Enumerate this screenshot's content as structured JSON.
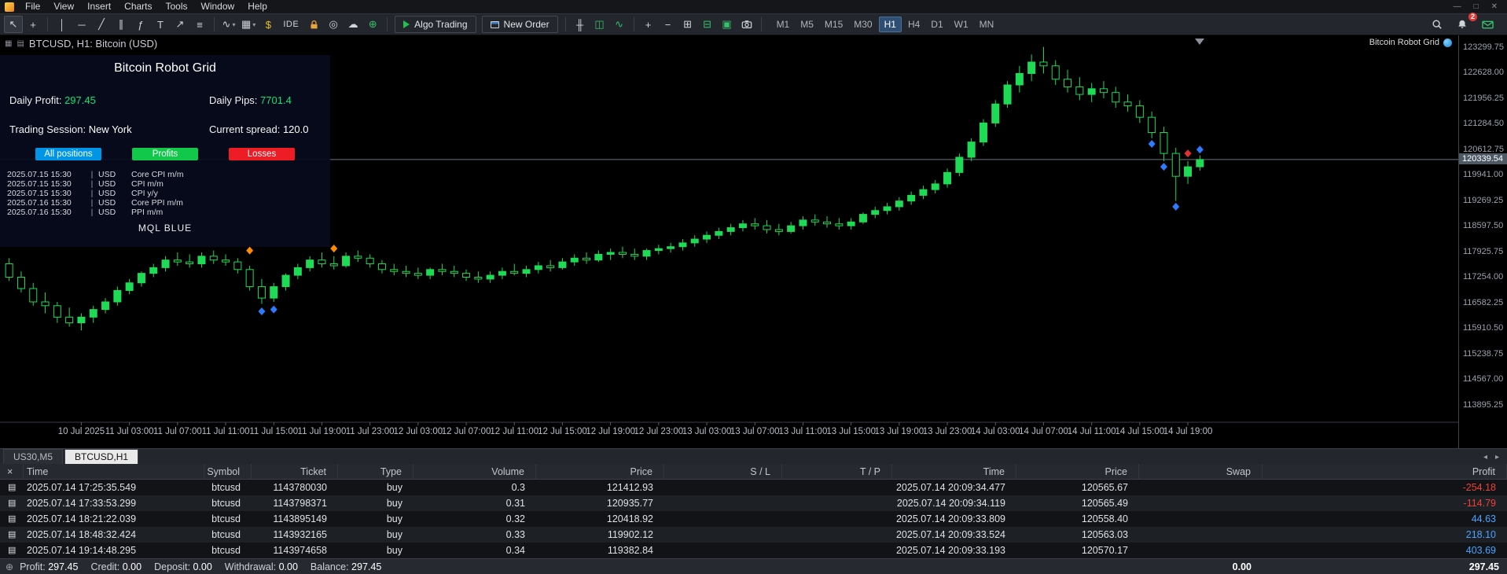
{
  "menu": {
    "items": [
      "File",
      "View",
      "Insert",
      "Charts",
      "Tools",
      "Window",
      "Help"
    ]
  },
  "window_controls": {
    "minimize": "—",
    "maximize": "□",
    "close": "✕"
  },
  "toolbar": {
    "items": [
      {
        "k": "tool",
        "n": "cursor-tool",
        "g": "↖",
        "sel": true
      },
      {
        "k": "tool",
        "n": "crosshair-tool",
        "g": "+"
      },
      {
        "k": "sep"
      },
      {
        "k": "tool",
        "n": "vertical-line-tool",
        "g": "│"
      },
      {
        "k": "tool",
        "n": "horizontal-line-tool",
        "g": "─"
      },
      {
        "k": "tool",
        "n": "trendline-tool",
        "g": "╱"
      },
      {
        "k": "tool",
        "n": "equidistant-channel-tool",
        "g": "∥"
      },
      {
        "k": "tool",
        "n": "fibonacci-tool",
        "g": "ƒ"
      },
      {
        "k": "tool",
        "n": "text-tool",
        "g": "T"
      },
      {
        "k": "tool",
        "n": "arrows-tool",
        "g": "↗"
      },
      {
        "k": "tool",
        "n": "objects-list-icon",
        "g": "≡"
      },
      {
        "k": "sep"
      },
      {
        "k": "tool",
        "n": "indicators-icon",
        "g": "∿",
        "caret": true
      },
      {
        "k": "tool",
        "n": "chart-template-icon",
        "g": "▦",
        "caret": true
      },
      {
        "k": "tool",
        "n": "dollar-icon",
        "g": "$",
        "c": "#e8c210"
      },
      {
        "k": "ide",
        "n": "ide-button",
        "label": "IDE"
      },
      {
        "k": "svg",
        "n": "lock-icon",
        "svg": "lock"
      },
      {
        "k": "tool",
        "n": "signals-icon",
        "g": "◎"
      },
      {
        "k": "tool",
        "n": "cloud-icon",
        "g": "☁"
      },
      {
        "k": "tool",
        "n": "community-icon",
        "g": "⊕",
        "c": "#35c06a"
      },
      {
        "k": "sep"
      },
      {
        "k": "algo",
        "n": "algo-trading-button",
        "label": "Algo Trading"
      },
      {
        "k": "neworder",
        "n": "new-order-button",
        "label": "New Order"
      },
      {
        "k": "sep"
      },
      {
        "k": "tool",
        "n": "bar-chart-icon",
        "g": "╫"
      },
      {
        "k": "tool",
        "n": "candlestick-chart-icon",
        "g": "◫",
        "c": "#35c06a"
      },
      {
        "k": "tool",
        "n": "line-chart-icon",
        "g": "∿",
        "c": "#35c06a"
      },
      {
        "k": "sep"
      },
      {
        "k": "tool",
        "n": "zoom-in-icon",
        "g": "+"
      },
      {
        "k": "tool",
        "n": "zoom-out-icon",
        "g": "−"
      },
      {
        "k": "tool",
        "n": "grid-icon",
        "g": "⊞"
      },
      {
        "k": "tool",
        "n": "tile-windows-icon",
        "g": "⊟",
        "c": "#35c06a"
      },
      {
        "k": "tool",
        "n": "cascade-windows-icon",
        "g": "▣",
        "c": "#35c06a"
      },
      {
        "k": "svg",
        "n": "camera-icon",
        "svg": "camera"
      },
      {
        "k": "sep"
      }
    ],
    "timeframes": [
      {
        "label": "M1",
        "cls": ""
      },
      {
        "label": "M5",
        "cls": ""
      },
      {
        "label": "M15",
        "cls": ""
      },
      {
        "label": "M30",
        "cls": ""
      },
      {
        "label": "H1",
        "cls": "active"
      },
      {
        "label": "H4",
        "cls": ""
      },
      {
        "label": "D1",
        "cls": ""
      },
      {
        "label": "W1",
        "cls": ""
      },
      {
        "label": "MN",
        "cls": ""
      }
    ],
    "right": [
      {
        "n": "search-icon",
        "svg": "search"
      },
      {
        "n": "notifications-bell-icon",
        "svg": "bell",
        "badge": "2"
      },
      {
        "n": "mail-icon",
        "svg": "mail"
      }
    ]
  },
  "chart": {
    "title": "BTCUSD, H1:  Bitcoin (USD)",
    "overlay_right": "Bitcoin Robot Grid",
    "panel": {
      "title": "Bitcoin Robot Grid",
      "daily_profit_label": "Daily Profit: ",
      "daily_profit": "297.45",
      "daily_pips_label": "Daily Pips:  ",
      "daily_pips": "7701.4",
      "session_label": "Trading Session: ",
      "session": "New York",
      "spread_label": "Current spread: ",
      "spread": "120.0",
      "buttons": [
        {
          "label": "All positions",
          "bg": "#0096e8",
          "fg": "#ffffff"
        },
        {
          "label": "Profits",
          "bg": "#12c84b",
          "fg": "#ffffff"
        },
        {
          "label": "Losses",
          "bg": "#ee1c25",
          "fg": "#ffffff"
        }
      ],
      "news_sep": "|",
      "news": [
        {
          "time": "2025.07.15 15:30",
          "currency": "USD",
          "event": "Core CPI m/m"
        },
        {
          "time": "2025.07.15 15:30",
          "currency": "USD",
          "event": "CPI m/m"
        },
        {
          "time": "2025.07.15 15:30",
          "currency": "USD",
          "event": "CPI y/y"
        },
        {
          "time": "2025.07.16 15:30",
          "currency": "USD",
          "event": "Core PPI m/m"
        },
        {
          "time": "2025.07.16 15:30",
          "currency": "USD",
          "event": "PPI m/m"
        }
      ],
      "footer": "MQL BLUE"
    }
  },
  "chart_data": {
    "type": "candlestick",
    "symbol": "BTCUSD",
    "timeframe": "H1",
    "title": "BTCUSD, H1: Bitcoin (USD)",
    "ylim": [
      113480,
      123560
    ],
    "current_price": 120339.54,
    "current_price_label": "120339.54",
    "price_axis_ticks": [
      "123299.75",
      "122628.00",
      "121956.25",
      "121284.50",
      "120612.75",
      "119941.00",
      "119269.25",
      "118597.50",
      "117925.75",
      "117254.00",
      "116582.25",
      "115910.50",
      "115238.75",
      "114567.00",
      "113895.25"
    ],
    "x_labels": [
      "10 Jul 2025",
      "11 Jul 03:00",
      "11 Jul 07:00",
      "11 Jul 11:00",
      "11 Jul 15:00",
      "11 Jul 19:00",
      "11 Jul 23:00",
      "12 Jul 03:00",
      "12 Jul 07:00",
      "12 Jul 11:00",
      "12 Jul 15:00",
      "12 Jul 19:00",
      "12 Jul 23:00",
      "13 Jul 03:00",
      "13 Jul 07:00",
      "13 Jul 11:00",
      "13 Jul 15:00",
      "13 Jul 19:00",
      "13 Jul 23:00",
      "14 Jul 03:00",
      "14 Jul 07:00",
      "14 Jul 11:00",
      "14 Jul 15:00",
      "14 Jul 19:00"
    ],
    "x_label_candle_indices": [
      6,
      10,
      14,
      18,
      22,
      26,
      30,
      34,
      38,
      42,
      46,
      50,
      54,
      58,
      62,
      66,
      70,
      74,
      78,
      82,
      86,
      90,
      94,
      98
    ],
    "colors": {
      "bull": "#1fda55",
      "bear_fill": "#000000",
      "wick": "#1fda55",
      "price_line": "#6a7480"
    },
    "candles": [
      [
        117600,
        117750,
        117150,
        117250
      ],
      [
        117250,
        117400,
        116850,
        116950
      ],
      [
        116950,
        117100,
        116500,
        116600
      ],
      [
        116600,
        116850,
        116300,
        116500
      ],
      [
        116500,
        116600,
        116050,
        116200
      ],
      [
        116200,
        116450,
        115950,
        116050
      ],
      [
        116050,
        116300,
        115850,
        116200
      ],
      [
        116200,
        116500,
        116050,
        116400
      ],
      [
        116400,
        116700,
        116300,
        116600
      ],
      [
        116600,
        117000,
        116500,
        116900
      ],
      [
        116900,
        117200,
        116800,
        117100
      ],
      [
        117100,
        117400,
        117000,
        117350
      ],
      [
        117350,
        117600,
        117250,
        117500
      ],
      [
        117500,
        117800,
        117400,
        117700
      ],
      [
        117700,
        117900,
        117550,
        117650
      ],
      [
        117650,
        117850,
        117500,
        117600
      ],
      [
        117600,
        117900,
        117500,
        117800
      ],
      [
        117800,
        117950,
        117600,
        117700
      ],
      [
        117700,
        117850,
        117550,
        117650
      ],
      [
        117650,
        117750,
        117350,
        117450
      ],
      [
        117450,
        117550,
        116900,
        117000
      ],
      [
        117000,
        117200,
        116550,
        116700
      ],
      [
        116700,
        117100,
        116600,
        117000
      ],
      [
        117000,
        117350,
        116900,
        117300
      ],
      [
        117300,
        117600,
        117200,
        117500
      ],
      [
        117500,
        117800,
        117400,
        117700
      ],
      [
        117700,
        117900,
        117500,
        117600
      ],
      [
        117600,
        117800,
        117450,
        117550
      ],
      [
        117550,
        117900,
        117500,
        117800
      ],
      [
        117800,
        117950,
        117650,
        117750
      ],
      [
        117750,
        117850,
        117500,
        117600
      ],
      [
        117600,
        117700,
        117350,
        117450
      ],
      [
        117450,
        117600,
        117300,
        117400
      ],
      [
        117400,
        117550,
        117250,
        117350
      ],
      [
        117350,
        117500,
        117200,
        117300
      ],
      [
        117300,
        117500,
        117200,
        117450
      ],
      [
        117450,
        117600,
        117300,
        117400
      ],
      [
        117400,
        117550,
        117250,
        117350
      ],
      [
        117350,
        117450,
        117150,
        117250
      ],
      [
        117250,
        117400,
        117100,
        117200
      ],
      [
        117200,
        117400,
        117100,
        117300
      ],
      [
        117300,
        117500,
        117200,
        117400
      ],
      [
        117400,
        117600,
        117300,
        117350
      ],
      [
        117350,
        117550,
        117250,
        117450
      ],
      [
        117450,
        117650,
        117350,
        117550
      ],
      [
        117550,
        117700,
        117400,
        117500
      ],
      [
        117500,
        117750,
        117450,
        117650
      ],
      [
        117650,
        117850,
        117550,
        117750
      ],
      [
        117750,
        117900,
        117600,
        117700
      ],
      [
        117700,
        117950,
        117650,
        117850
      ],
      [
        117850,
        118000,
        117700,
        117900
      ],
      [
        117900,
        118050,
        117750,
        117850
      ],
      [
        117850,
        118000,
        117700,
        117800
      ],
      [
        117800,
        118000,
        117700,
        117950
      ],
      [
        117950,
        118100,
        117850,
        118000
      ],
      [
        118000,
        118150,
        117900,
        118050
      ],
      [
        118050,
        118250,
        117950,
        118150
      ],
      [
        118150,
        118350,
        118050,
        118250
      ],
      [
        118250,
        118450,
        118150,
        118350
      ],
      [
        118350,
        118550,
        118250,
        118450
      ],
      [
        118450,
        118650,
        118350,
        118550
      ],
      [
        118550,
        118750,
        118450,
        118650
      ],
      [
        118650,
        118800,
        118500,
        118600
      ],
      [
        118600,
        118750,
        118400,
        118500
      ],
      [
        118500,
        118650,
        118350,
        118450
      ],
      [
        118450,
        118700,
        118400,
        118600
      ],
      [
        118600,
        118850,
        118500,
        118750
      ],
      [
        118750,
        118900,
        118600,
        118700
      ],
      [
        118700,
        118850,
        118550,
        118650
      ],
      [
        118650,
        118800,
        118500,
        118600
      ],
      [
        118600,
        118800,
        118500,
        118700
      ],
      [
        118700,
        118950,
        118650,
        118900
      ],
      [
        118900,
        119100,
        118800,
        119000
      ],
      [
        119000,
        119200,
        118900,
        119100
      ],
      [
        119100,
        119350,
        119000,
        119250
      ],
      [
        119250,
        119500,
        119150,
        119400
      ],
      [
        119400,
        119650,
        119300,
        119550
      ],
      [
        119550,
        119800,
        119450,
        119700
      ],
      [
        119700,
        120100,
        119600,
        120000
      ],
      [
        120000,
        120500,
        119900,
        120400
      ],
      [
        120400,
        120900,
        120300,
        120800
      ],
      [
        120800,
        121400,
        120700,
        121300
      ],
      [
        121300,
        121900,
        121200,
        121800
      ],
      [
        121800,
        122400,
        121700,
        122300
      ],
      [
        122300,
        122800,
        122100,
        122600
      ],
      [
        122600,
        123100,
        122400,
        122900
      ],
      [
        122900,
        123299,
        122600,
        122800
      ],
      [
        122800,
        122950,
        122300,
        122450
      ],
      [
        122450,
        122700,
        122100,
        122250
      ],
      [
        122250,
        122500,
        121900,
        122050
      ],
      [
        122050,
        122350,
        121850,
        122200
      ],
      [
        122200,
        122400,
        121950,
        122100
      ],
      [
        122100,
        122250,
        121700,
        121850
      ],
      [
        121850,
        122050,
        121600,
        121750
      ],
      [
        121750,
        121900,
        121300,
        121450
      ],
      [
        121450,
        121600,
        120900,
        121050
      ],
      [
        121050,
        121200,
        120300,
        120500
      ],
      [
        120500,
        120650,
        119250,
        119900
      ],
      [
        119900,
        120300,
        119700,
        120150
      ],
      [
        120150,
        120450,
        120050,
        120340
      ]
    ],
    "markers": [
      {
        "i": 20,
        "p": 117950,
        "color": "#ff8c00"
      },
      {
        "i": 21,
        "p": 116350,
        "color": "#2f7bff"
      },
      {
        "i": 22,
        "p": 116400,
        "color": "#2f7bff"
      },
      {
        "i": 27,
        "p": 118000,
        "color": "#ff8c00"
      },
      {
        "i": 95,
        "p": 120750,
        "color": "#2f7bff"
      },
      {
        "i": 96,
        "p": 120150,
        "color": "#2f7bff"
      },
      {
        "i": 97,
        "p": 119100,
        "color": "#2f7bff"
      },
      {
        "i": 98,
        "p": 120500,
        "color": "#e03030"
      },
      {
        "i": 99,
        "p": 120600,
        "color": "#2f7bff"
      }
    ]
  },
  "tabs": {
    "items": [
      {
        "label": "US30,M5",
        "cls": ""
      },
      {
        "label": "BTCUSD,H1",
        "cls": "active"
      }
    ],
    "arrow_left": "◂",
    "arrow_right": "▸"
  },
  "table": {
    "close_label": "×",
    "doc_icon": "▤",
    "headers": [
      {
        "label": "Time",
        "cls": "left",
        "arrow": "▲"
      },
      {
        "label": "Symbol"
      },
      {
        "label": "Ticket"
      },
      {
        "label": "Type"
      },
      {
        "label": "Volume"
      },
      {
        "label": "Price"
      },
      {
        "label": "S / L"
      },
      {
        "label": "T / P"
      },
      {
        "label": "Time"
      },
      {
        "label": "Price"
      },
      {
        "label": "Swap"
      },
      {
        "label": "Profit"
      }
    ],
    "rows": [
      {
        "time": "2025.07.14 17:25:35.549",
        "symbol": "btcusd",
        "ticket": "1143780030",
        "type": "buy",
        "volume": "0.3",
        "price": "121412.93",
        "sl": "",
        "tp": "",
        "time2": "2025.07.14 20:09:34.477",
        "price2": "120565.67",
        "swap": "",
        "profit": "-254.18",
        "profit_color": "#ef4036"
      },
      {
        "time": "2025.07.14 17:33:53.299",
        "symbol": "btcusd",
        "ticket": "1143798371",
        "type": "buy",
        "volume": "0.31",
        "price": "120935.77",
        "sl": "",
        "tp": "",
        "time2": "2025.07.14 20:09:34.119",
        "price2": "120565.49",
        "swap": "",
        "profit": "-114.79",
        "profit_color": "#ef4036"
      },
      {
        "time": "2025.07.14 18:21:22.039",
        "symbol": "btcusd",
        "ticket": "1143895149",
        "type": "buy",
        "volume": "0.32",
        "price": "120418.92",
        "sl": "",
        "tp": "",
        "time2": "2025.07.14 20:09:33.809",
        "price2": "120558.40",
        "swap": "",
        "profit": "44.63",
        "profit_color": "#4aa3ff"
      },
      {
        "time": "2025.07.14 18:48:32.424",
        "symbol": "btcusd",
        "ticket": "1143932165",
        "type": "buy",
        "volume": "0.33",
        "price": "119902.12",
        "sl": "",
        "tp": "",
        "time2": "2025.07.14 20:09:33.524",
        "price2": "120563.03",
        "swap": "",
        "profit": "218.10",
        "profit_color": "#4aa3ff"
      },
      {
        "time": "2025.07.14 19:14:48.295",
        "symbol": "btcusd",
        "ticket": "1143974658",
        "type": "buy",
        "volume": "0.34",
        "price": "119382.84",
        "sl": "",
        "tp": "",
        "time2": "2025.07.14 20:09:33.193",
        "price2": "120570.17",
        "swap": "",
        "profit": "403.69",
        "profit_color": "#4aa3ff"
      }
    ]
  },
  "status_bar": {
    "icon": "⊕",
    "items": [
      {
        "label": "Profit:",
        "value": "297.45"
      },
      {
        "label": "Credit:",
        "value": "0.00"
      },
      {
        "label": "Deposit:",
        "value": "0.00"
      },
      {
        "label": "Withdrawal:",
        "value": "0.00"
      },
      {
        "label": "Balance:",
        "value": "297.45"
      }
    ],
    "swap_total": "0.00",
    "profit_total": "297.45"
  }
}
